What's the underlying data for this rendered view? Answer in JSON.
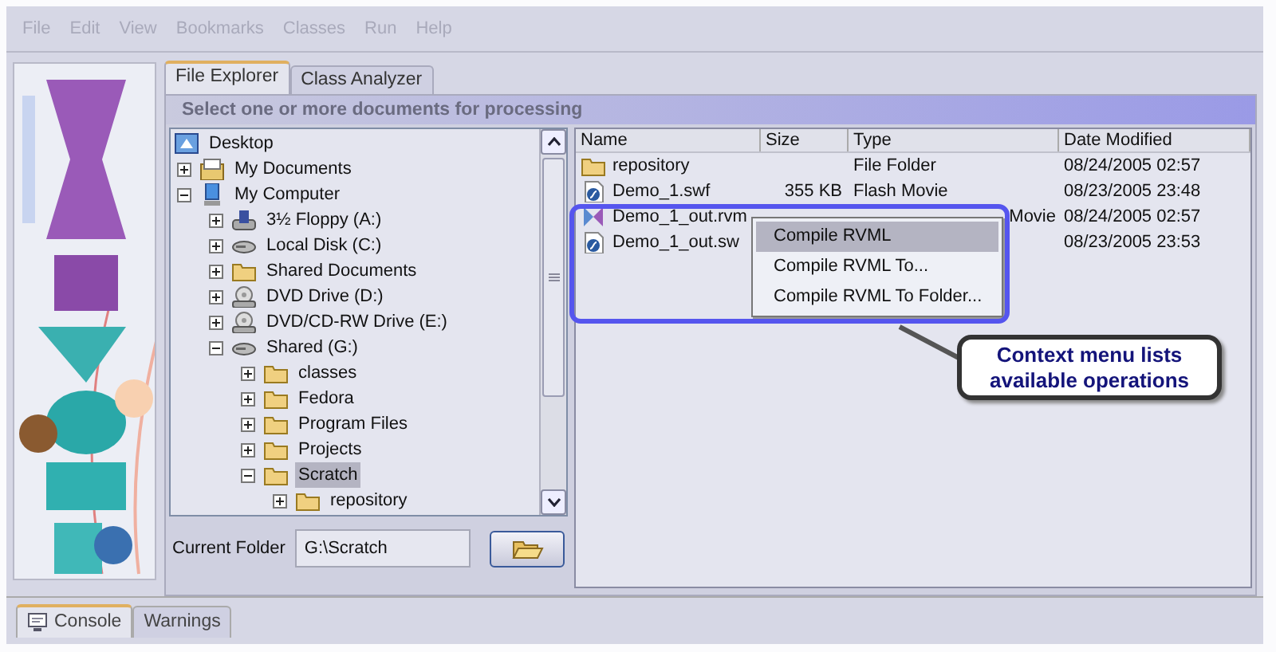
{
  "menu": [
    {
      "label": "File"
    },
    {
      "label": "Edit"
    },
    {
      "label": "View"
    },
    {
      "label": "Bookmarks"
    },
    {
      "label": "Classes"
    },
    {
      "label": "Run"
    },
    {
      "label": "Help"
    }
  ],
  "tabs": [
    {
      "label": "File Explorer",
      "selected": true
    },
    {
      "label": "Class Analyzer",
      "selected": false
    }
  ],
  "panel_header": "Select one or more documents for processing",
  "tree": [
    {
      "label": "Desktop",
      "kind": "desktop",
      "selected": false,
      "children": [
        {
          "label": "My Documents",
          "kind": "documents",
          "expanded": false,
          "selected": false
        },
        {
          "label": "My Computer",
          "kind": "computer",
          "expanded": true,
          "selected": false,
          "children": [
            {
              "label": "3½ Floppy (A:)",
              "kind": "floppy",
              "expanded": false,
              "selected": false
            },
            {
              "label": "Local Disk (C:)",
              "kind": "disk",
              "expanded": false,
              "selected": false
            },
            {
              "label": "Shared Documents",
              "kind": "folder",
              "expanded": false,
              "selected": false
            },
            {
              "label": "DVD Drive (D:)",
              "kind": "dvd",
              "expanded": false,
              "selected": false
            },
            {
              "label": "DVD/CD-RW Drive (E:)",
              "kind": "dvd",
              "expanded": false,
              "selected": false
            },
            {
              "label": "Shared (G:)",
              "kind": "disk",
              "expanded": true,
              "selected": false,
              "children": [
                {
                  "label": "classes",
                  "kind": "folder",
                  "expanded": false,
                  "selected": false
                },
                {
                  "label": "Fedora",
                  "kind": "folder",
                  "expanded": false,
                  "selected": false
                },
                {
                  "label": "Program Files",
                  "kind": "folder",
                  "expanded": false,
                  "selected": false
                },
                {
                  "label": "Projects",
                  "kind": "folder",
                  "expanded": false,
                  "selected": false
                },
                {
                  "label": "Scratch",
                  "kind": "folder",
                  "expanded": true,
                  "selected": true,
                  "children": [
                    {
                      "label": "repository",
                      "kind": "folder",
                      "expanded": false,
                      "selected": false
                    }
                  ]
                }
              ]
            }
          ]
        }
      ]
    }
  ],
  "current_folder": {
    "label": "Current Folder",
    "value": "G:\\Scratch"
  },
  "files": {
    "columns": [
      "Name",
      "Size",
      "Type",
      "Date Modified"
    ],
    "rows": [
      {
        "kind": "folder",
        "name": "repository",
        "type": "File Folder",
        "date": "08/24/2005 02:57"
      },
      {
        "kind": "flash",
        "name": "Demo_1.swf",
        "size": "355 KB",
        "type": "Flash Movie",
        "date": "08/23/2005 23:48"
      },
      {
        "kind": "rvml",
        "name": "Demo_1_out.rvm",
        "type": "Movie",
        "date": "08/24/2005 02:57"
      },
      {
        "kind": "flash",
        "name": "Demo_1_out.sw",
        "date": "08/23/2005 23:53"
      }
    ]
  },
  "context_menu": [
    {
      "label": "Compile RVML",
      "selected": true
    },
    {
      "label": "Compile RVML To...",
      "selected": false
    },
    {
      "label": "Compile RVML To Folder...",
      "selected": false
    }
  ],
  "callout": "Context menu lists\navailable operations",
  "bottom_tabs": [
    {
      "label": "Console",
      "kind": "monitor",
      "selected": true
    },
    {
      "label": "Warnings",
      "selected": false
    }
  ]
}
